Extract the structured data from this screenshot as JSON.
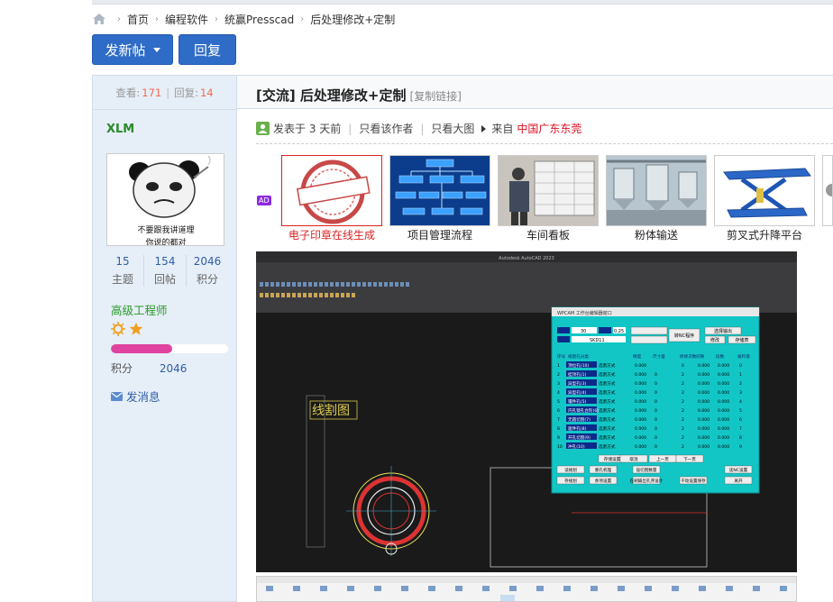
{
  "breadcrumb": [
    "首页",
    "编程软件",
    "统赢Presscad",
    "后处理修改+定制"
  ],
  "actions": {
    "new_post": "发新帖",
    "reply": "回复"
  },
  "thread_stats": {
    "views_label": "查看:",
    "views": "171",
    "replies_label": "回复:",
    "replies": "14"
  },
  "author": {
    "name": "XLM",
    "avatar_caption": "不要跟我讲道理",
    "avatar_caption2": "你说的都对",
    "stats": [
      {
        "value": "15",
        "label": "主题"
      },
      {
        "value": "154",
        "label": "回帖"
      },
      {
        "value": "2046",
        "label": "积分"
      }
    ],
    "rank": "高级工程师",
    "progress": 0.52,
    "points_label": "积分",
    "points": "2046",
    "message": "发消息"
  },
  "post": {
    "title": "[交流] 后处理修改+定制",
    "copy_link": "[复制链接]",
    "posted": "发表于 3 天前",
    "author_only": "只看该作者",
    "big_image": "只看大图",
    "from_label": "来自",
    "location": "中国广东东莞"
  },
  "ad_badge": "AD",
  "ads": [
    {
      "caption": "电子印章在线生成",
      "selected": true
    },
    {
      "caption": "项目管理流程",
      "selected": false
    },
    {
      "caption": "车间看板",
      "selected": false
    },
    {
      "caption": "粉体输送",
      "selected": false
    },
    {
      "caption": "剪叉式升降平台",
      "selected": false
    }
  ],
  "cad": {
    "app_title": "Autodesk AutoCAD 2023",
    "dialog_title": "WPCAM 工作台编辑器窗口",
    "buttons": [
      "转NC程序",
      "选择输出",
      "修改",
      "存储表"
    ],
    "field1": "30",
    "field2": "0.25",
    "field3": "SKD11",
    "col_headers": [
      "序号",
      "线割孔分类",
      "",
      "精度",
      "尺寸差",
      "修修次数",
      "间隙",
      "段数",
      "备料值"
    ],
    "rows": [
      [
        "1",
        "顶位孔(10)",
        "选割方式",
        "0.000",
        "",
        "0",
        "0.000",
        "0.000",
        "0"
      ],
      [
        "2",
        "挂顶孔(1)",
        "选割方式",
        "0.000",
        "0",
        "2",
        "0.000",
        "0.000",
        "1"
      ],
      [
        "3",
        "异型孔(3)",
        "选割方式",
        "0.000",
        "0",
        "2",
        "0.000",
        "0.000",
        "2"
      ],
      [
        "4",
        "异型孔(4)",
        "选割方式",
        "0.000",
        "0",
        "2",
        "0.000",
        "0.000",
        "3"
      ],
      [
        "5",
        "镶件孔(5)",
        "选割方式",
        "0.000",
        "0",
        "2",
        "0.000",
        "0.000",
        "4"
      ],
      [
        "6",
        "内孔镜孔台阶(6)",
        "选割方式",
        "0.000",
        "0",
        "2",
        "0.000",
        "0.000",
        "5"
      ],
      [
        "7",
        "无圆切割(7)",
        "选割方式",
        "0.000",
        "0",
        "2",
        "0.000",
        "0.000",
        "6"
      ],
      [
        "8",
        "驱件孔(8)",
        "选割方式",
        "0.000",
        "0",
        "2",
        "0.000",
        "0.000",
        "7"
      ],
      [
        "9",
        "开孔切割(9)",
        "选割方式",
        "0.000",
        "0",
        "2",
        "0.000",
        "0.000",
        "8"
      ],
      [
        "10",
        "冲孔(10)",
        "选割方式",
        "0.000",
        "0",
        "2",
        "0.000",
        "0.000",
        "9"
      ]
    ],
    "bottom_buttons": [
      "存储设置",
      "取消",
      "上一页",
      "下一页",
      "读规划",
      "重孔机理",
      "设切割数量",
      "读NC设置",
      "存规划",
      "余项设置",
      "在刷输出孔序设计",
      "干动设置保存",
      "离开"
    ],
    "drawing_label": "线割图"
  },
  "colors": {
    "brand": "#2f6cc7",
    "accent": "#f26c4f",
    "rank": "#2a9a2a",
    "progress": "#e0429f",
    "ad_selected": "#dd2222",
    "dialog": "#13c6c6"
  }
}
